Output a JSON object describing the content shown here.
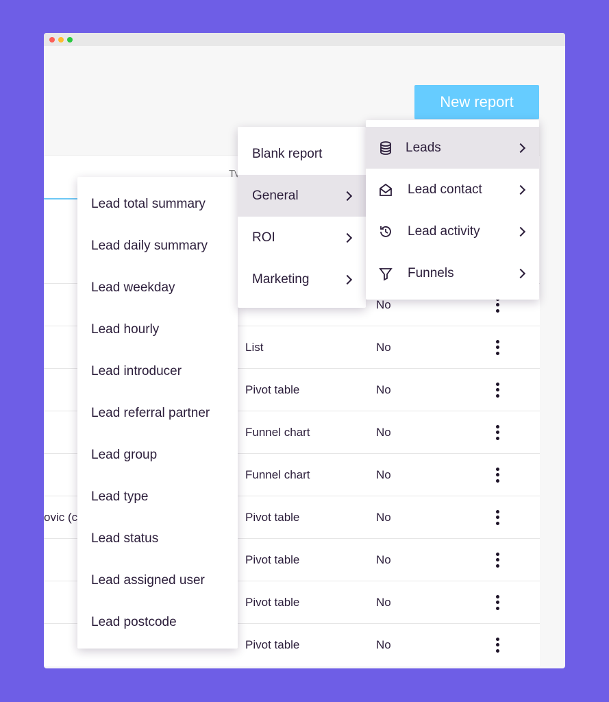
{
  "header": {
    "new_report_label": "New report"
  },
  "table": {
    "type_header": "Ty",
    "partial_name": "ovic (c",
    "rows": [
      {
        "type": "",
        "shared": "No"
      },
      {
        "type": "List",
        "shared": "No"
      },
      {
        "type": "Pivot table",
        "shared": "No"
      },
      {
        "type": "Funnel chart",
        "shared": "No"
      },
      {
        "type": "Funnel chart",
        "shared": "No"
      },
      {
        "type": "Pivot table",
        "shared": "No"
      },
      {
        "type": "Pivot table",
        "shared": "No"
      },
      {
        "type": "Pivot table",
        "shared": "No"
      },
      {
        "type": "Pivot table",
        "shared": "No"
      }
    ]
  },
  "menu_categories": {
    "items": [
      {
        "label": "Blank report"
      },
      {
        "label": "General",
        "selected": true
      },
      {
        "label": "ROI"
      },
      {
        "label": "Marketing"
      }
    ]
  },
  "menu_general": {
    "items": [
      {
        "label": "Leads",
        "icon": "database-icon",
        "selected": true
      },
      {
        "label": "Lead contact",
        "icon": "envelope-open-icon"
      },
      {
        "label": "Lead activity",
        "icon": "history-icon"
      },
      {
        "label": "Funnels",
        "icon": "filter-icon"
      }
    ]
  },
  "menu_leads": {
    "items": [
      "Lead total summary",
      "Lead daily summary",
      "Lead weekday",
      "Lead hourly",
      "Lead introducer",
      "Lead referral partner",
      "Lead group",
      "Lead type",
      "Lead status",
      "Lead assigned user",
      "Lead postcode"
    ]
  },
  "colors": {
    "background": "#6e5ee6",
    "accent": "#66ccff",
    "text": "#2b1d3a",
    "highlight": "#e7e4e9"
  }
}
